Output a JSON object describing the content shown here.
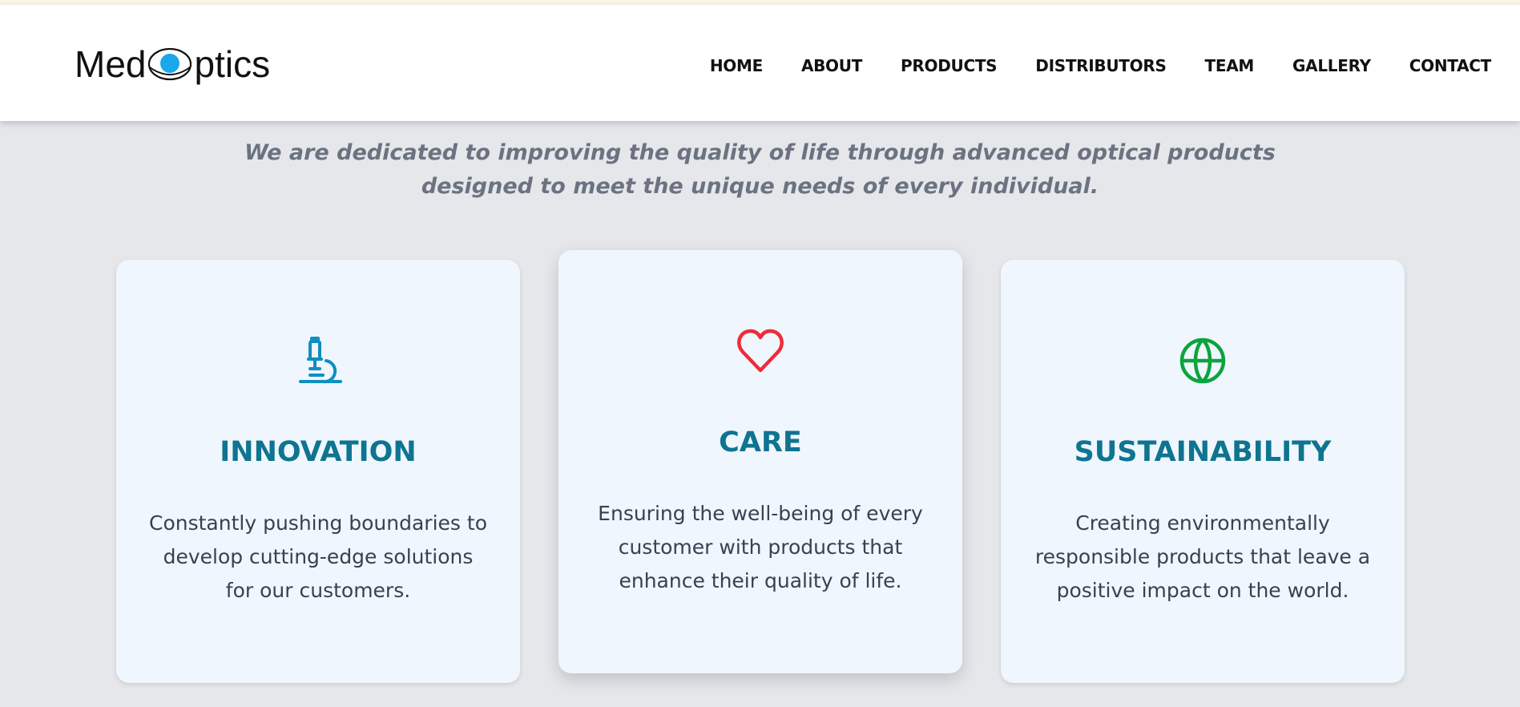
{
  "logo": {
    "text_before": "Med",
    "text_after": "ptics",
    "eye_color": "#1aa7ec"
  },
  "nav": {
    "items": [
      "HOME",
      "ABOUT",
      "PRODUCTS",
      "DISTRIBUTORS",
      "TEAM",
      "GALLERY",
      "CONTACT"
    ]
  },
  "tagline": {
    "line1": "We are dedicated to improving the quality of life through advanced optical products",
    "line2": "designed to meet the unique needs of every individual."
  },
  "cards": [
    {
      "icon": "microscope-icon",
      "icon_color": "#0e8fc0",
      "title": "INNOVATION",
      "text": "Constantly pushing boundaries to develop cutting-edge solutions for our customers."
    },
    {
      "icon": "heart-icon",
      "icon_color": "#ef2b3a",
      "title": "CARE",
      "text": "Ensuring the well-being of every customer with products that enhance their quality of life."
    },
    {
      "icon": "globe-icon",
      "icon_color": "#0aa43c",
      "title": "SUSTAINABILITY",
      "text": "Creating environmentally responsible products that leave a positive impact on the world."
    }
  ],
  "colors": {
    "background": "#e5e7eb",
    "card_background": "#eff6fd",
    "heading": "#0e7490",
    "tagline": "#6b7280"
  }
}
